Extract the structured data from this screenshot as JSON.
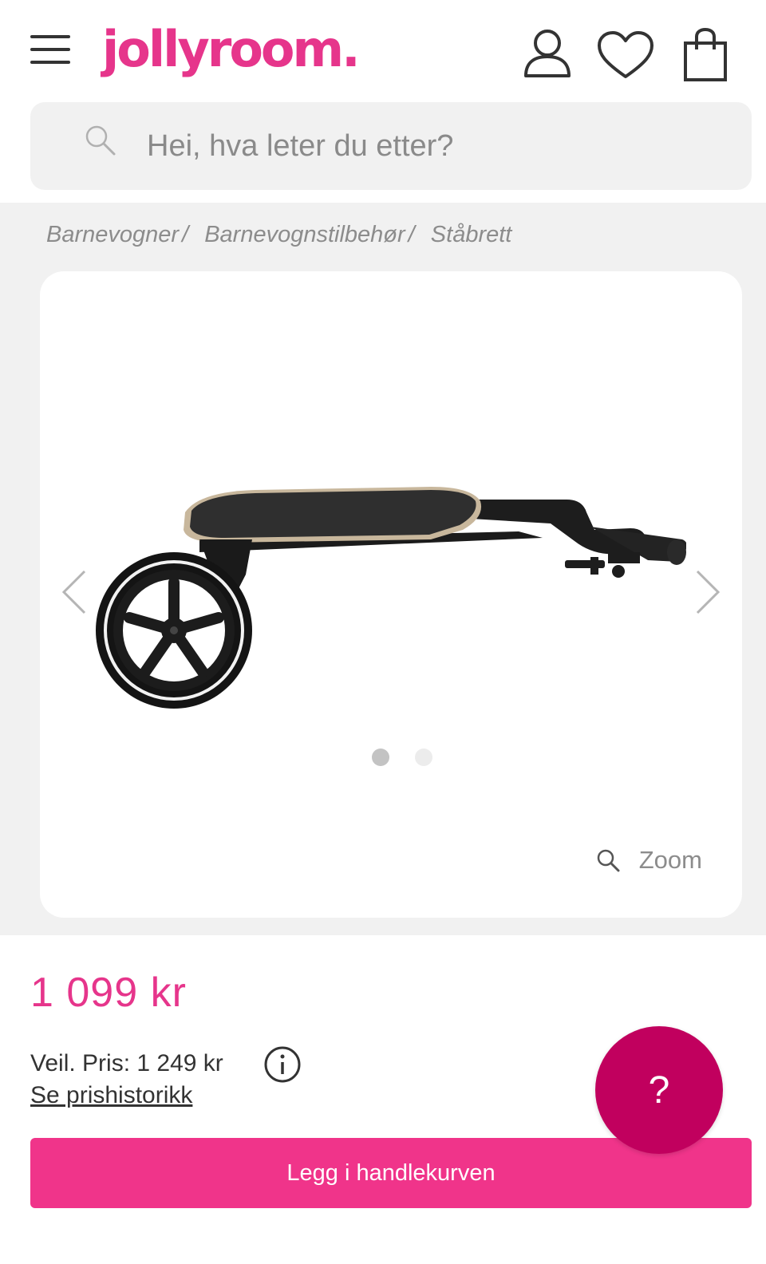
{
  "header": {
    "logo_text": "jollyroom.",
    "brand_color": "#e6358b"
  },
  "icons": {
    "menu": "hamburger-icon",
    "account": "user-icon",
    "wishlist": "heart-icon",
    "cart": "shopping-bag-icon",
    "search": "search-icon",
    "zoom": "magnifier-icon",
    "info": "info-icon"
  },
  "search": {
    "placeholder": "Hei, hva leter du etter?"
  },
  "breadcrumb": {
    "items": [
      "Barnevogner",
      "Barnevognstilbehør",
      "Ståbrett"
    ]
  },
  "gallery": {
    "image_count": 2,
    "active_index": 0,
    "zoom_label": "Zoom"
  },
  "product": {
    "price": "1 099 kr",
    "rrp": "Veil. Pris: 1 249 kr",
    "price_history_link": "Se prishistorikk",
    "add_to_cart_label": "Legg i handlekurven"
  },
  "help": {
    "label": "?"
  },
  "colors": {
    "accent": "#e6358b",
    "cart_button": "#f0348a",
    "help_button": "#c1005e",
    "background_gray": "#f1f1f1"
  }
}
